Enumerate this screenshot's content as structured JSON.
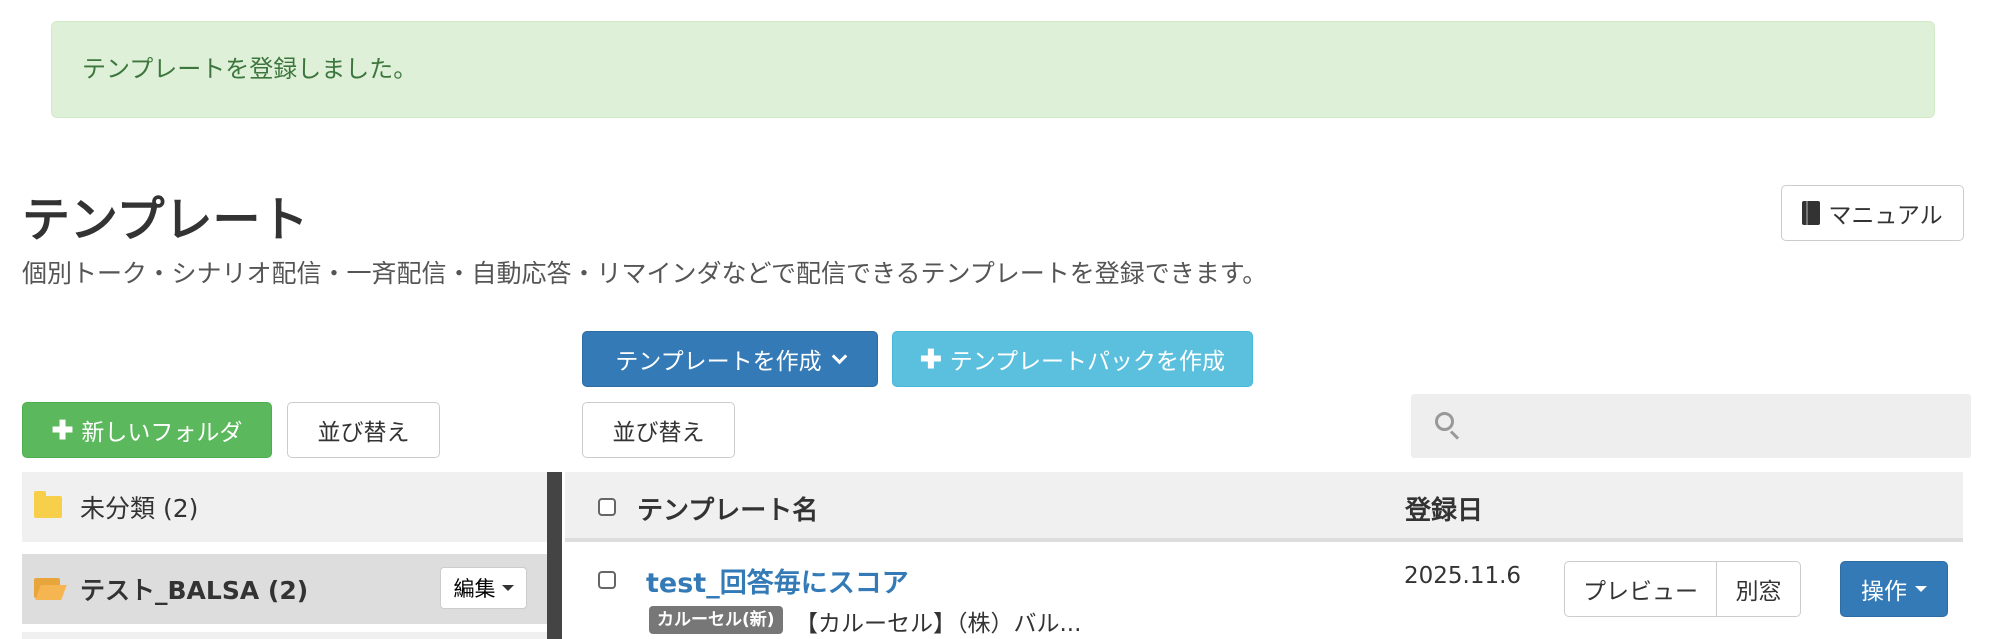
{
  "alert": {
    "message": "テンプレートを登録しました。"
  },
  "header": {
    "title": "テンプレート",
    "description": "個別トーク・シナリオ配信・一斉配信・自動応答・リマインダなどで配信できるテンプレートを登録できます。",
    "manual_label": "マニュアル"
  },
  "toolbar": {
    "create_template_label": "テンプレートを作成",
    "create_pack_label": "テンプレートパックを作成",
    "new_folder_label": "新しいフォルダ",
    "sort_label": "並び替え"
  },
  "search": {
    "placeholder": ""
  },
  "folders": [
    {
      "name": "未分類 (2)"
    },
    {
      "name": "テスト_BALSA (2)",
      "edit_label": "編集"
    }
  ],
  "table": {
    "columns": {
      "name": "テンプレート名",
      "date": "登録日"
    },
    "rows": [
      {
        "name": "test_回答毎にスコア",
        "badge": "カルーセル(新)",
        "description": "【カルーセル】（株）バル...",
        "date": "2025.11.6",
        "preview_label": "プレビュー",
        "window_label": "別窓",
        "ops_label": "操作"
      }
    ]
  },
  "colors": {
    "primary": "#337ab7",
    "info": "#5bc0de",
    "success": "#5cb85c",
    "alert_bg": "#dff0d8",
    "alert_text": "#3c763d"
  }
}
